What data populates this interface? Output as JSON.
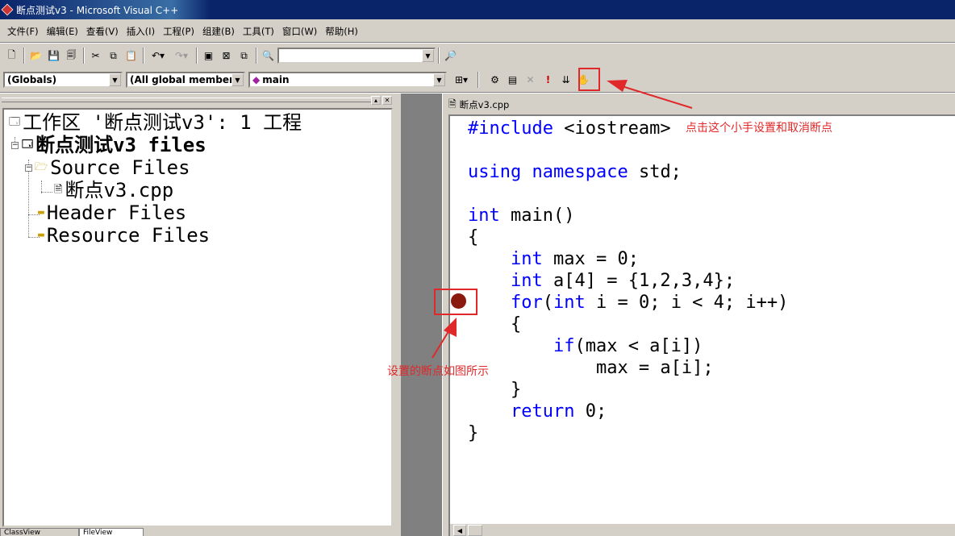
{
  "window": {
    "title": "断点测试v3 - Microsoft Visual C++"
  },
  "menu": [
    "文件(F)",
    "编辑(E)",
    "查看(V)",
    "插入(I)",
    "工程(P)",
    "组建(B)",
    "工具(T)",
    "窗口(W)",
    "帮助(H)"
  ],
  "wizard_bar": {
    "scope": "(Globals)",
    "members": "(All global members",
    "function": "main"
  },
  "workspace": {
    "root": "工作区 '断点测试v3': 1 工程",
    "project": "断点测试v3 files",
    "folders": {
      "source": "Source Files",
      "source_file": "断点v3.cpp",
      "header": "Header Files",
      "resource": "Resource Files"
    },
    "tabs": [
      "ClassView",
      "FileView"
    ]
  },
  "editor": {
    "filename": "断点v3.cpp",
    "code": {
      "l1_kw": "#include",
      "l1_rest": " <iostream>",
      "l2_kw1": "using",
      "l2_kw2": "namespace",
      "l2_rest": " std;",
      "l3_kw": "int",
      "l3_rest": " main()",
      "l4": "{",
      "l5_kw": "int",
      "l5_rest": " max = 0;",
      "l6_kw": "int",
      "l6_rest": " a[4] = {1,2,3,4};",
      "l7_kw1": "for",
      "l7_mid": "(",
      "l7_kw2": "int",
      "l7_rest": " i = 0; i < 4; i++)",
      "l8": "{",
      "l9_kw": "if",
      "l9_rest": "(max < a[i])",
      "l10": "max = a[i];",
      "l11": "}",
      "l12_kw": "return",
      "l12_rest": " 0;",
      "l13": "}"
    }
  },
  "annotations": {
    "hand_tip": "点击这个小手设置和取消断点",
    "breakpoint_tip": "设置的断点如图所示"
  },
  "colors": {
    "keyword": "#0000ff",
    "annotation": "#e0282a",
    "breakpoint": "#8a1a10",
    "titlebar": "#0a246a"
  }
}
